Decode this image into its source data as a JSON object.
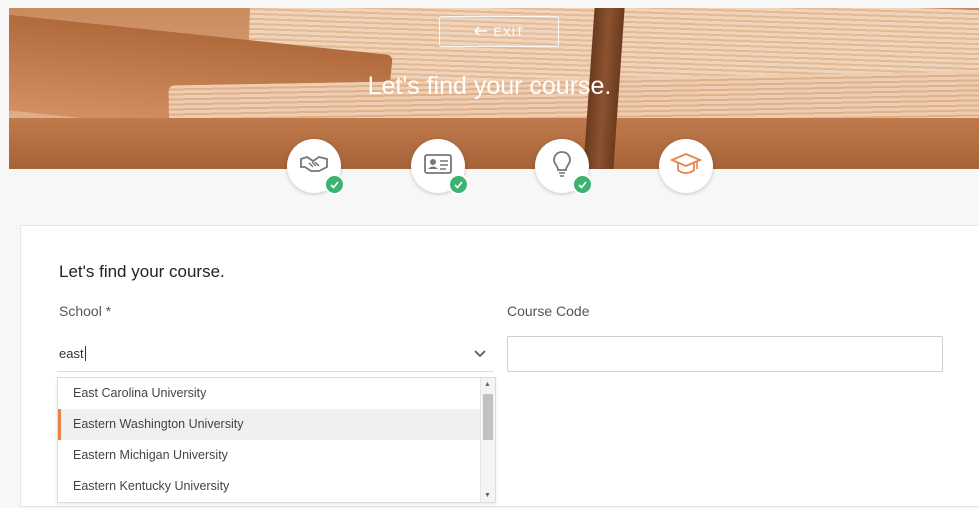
{
  "header": {
    "exit_label": "EXIT",
    "title": "Let's find your course."
  },
  "steps": [
    {
      "icon": "handshake-icon",
      "done": true
    },
    {
      "icon": "id-card-icon",
      "done": true
    },
    {
      "icon": "lightbulb-icon",
      "done": true
    },
    {
      "icon": "graduation-cap-icon",
      "done": false,
      "active": true
    }
  ],
  "form": {
    "title": "Let's find your course.",
    "school_label": "School *",
    "school_value": "east",
    "course_label": "Course Code",
    "course_value": ""
  },
  "dropdown": {
    "options": [
      "East Carolina University",
      "Eastern Washington University",
      "Eastern Michigan University",
      "Eastern Kentucky University"
    ],
    "highlighted_index": 1
  },
  "colors": {
    "accent": "#e8834a",
    "success": "#3cb371"
  }
}
